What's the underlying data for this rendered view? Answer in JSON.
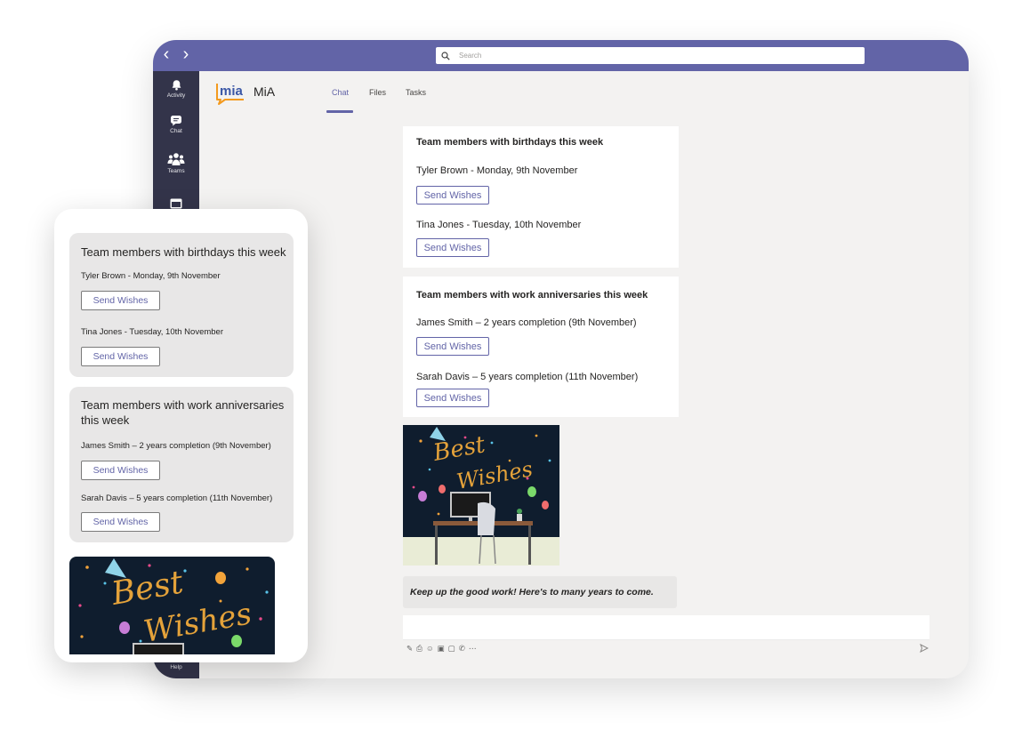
{
  "theme": {
    "accent": "#6264a7",
    "rail": "#33344a",
    "canvas": "#f3f2f1"
  },
  "search": {
    "placeholder": "Search"
  },
  "rail": [
    {
      "label": "Activity",
      "icon": "bell-icon"
    },
    {
      "label": "Chat",
      "icon": "chat-icon"
    },
    {
      "label": "Teams",
      "icon": "teams-icon"
    },
    {
      "label": "",
      "icon": "calendar-icon"
    },
    {
      "label": "Help",
      "icon": "help-icon"
    }
  ],
  "app": {
    "name": "MiA",
    "logo_text": "mia"
  },
  "tabs": [
    "Chat",
    "Files",
    "Tasks"
  ],
  "birthdays": {
    "title": "Team members with birthdays this week",
    "items": [
      {
        "text": "Tyler Brown - Monday, 9th November",
        "button": "Send Wishes"
      },
      {
        "text": "Tina Jones - Tuesday, 10th November",
        "button": "Send Wishes"
      }
    ]
  },
  "anniversaries": {
    "title": "Team members with work anniversaries this week",
    "items": [
      {
        "text": "James Smith – 2 years completion (9th November)",
        "button": "Send Wishes"
      },
      {
        "text": "Sarah Davis – 5 years completion (11th November)",
        "button": "Send Wishes"
      }
    ]
  },
  "greeting_image": {
    "line1": "Best",
    "line2": "Wishes"
  },
  "message": "Keep up the good work! Here's to many years to come.",
  "compose_tools": [
    "format-icon",
    "attach-icon",
    "emoji-icon",
    "gif-icon",
    "sticker-icon",
    "praise-icon",
    "more-icon"
  ],
  "mobile": {
    "birthdays": {
      "title": "Team members with birthdays this week",
      "items": [
        {
          "text": "Tyler Brown - Monday, 9th November",
          "button": "Send Wishes"
        },
        {
          "text": "Tina Jones - Tuesday, 10th November",
          "button": "Send Wishes"
        }
      ]
    },
    "anniversaries": {
      "title": "Team members with work anniversaries this week",
      "items": [
        {
          "text": "James Smith – 2 years completion (9th November)",
          "button": "Send Wishes"
        },
        {
          "text": "Sarah Davis – 5 years completion (11th November)",
          "button": "Send Wishes"
        }
      ]
    }
  }
}
